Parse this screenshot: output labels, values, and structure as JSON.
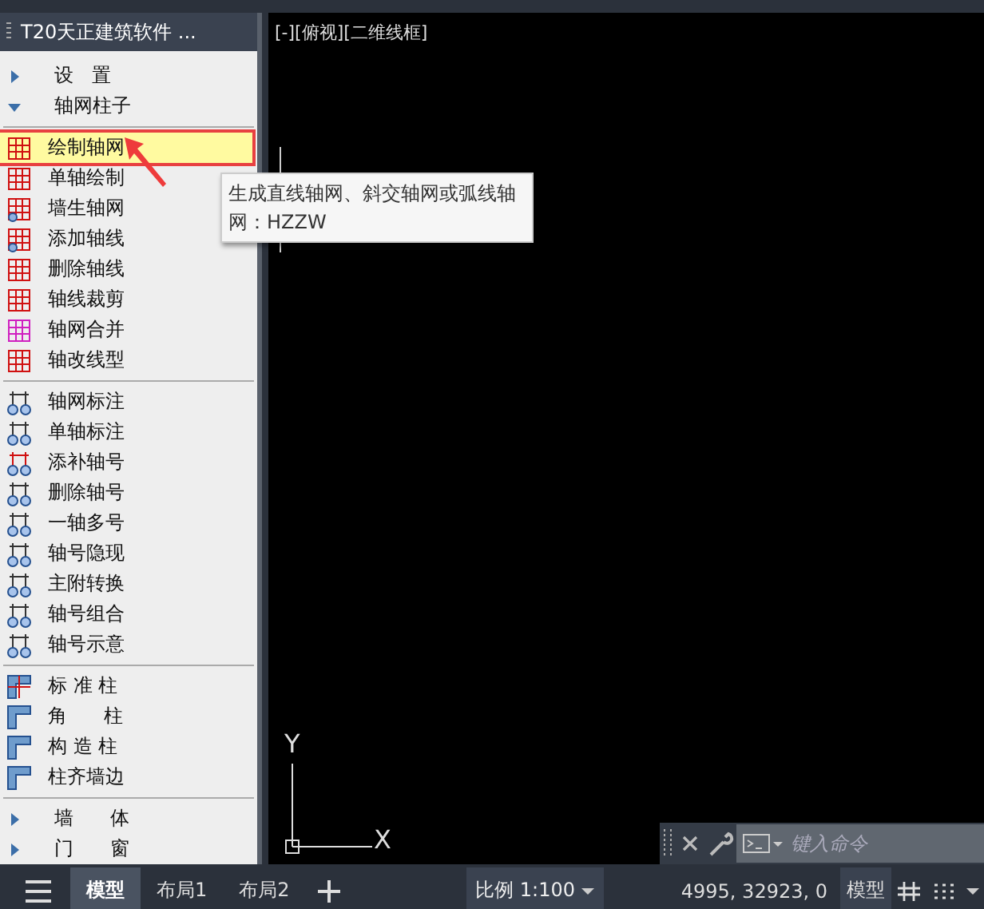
{
  "palette": {
    "title": "T20天正建筑软件 ...",
    "items": [
      {
        "kind": "group",
        "label": "设   置",
        "expanded": false
      },
      {
        "kind": "group",
        "label": "轴网柱子",
        "expanded": true
      },
      {
        "kind": "separator"
      },
      {
        "kind": "tool",
        "label": "绘制轴网",
        "selected": true
      },
      {
        "kind": "tool",
        "label": "单轴绘制",
        "selected": false
      },
      {
        "kind": "tool",
        "label": "墙生轴网",
        "selected": false
      },
      {
        "kind": "tool",
        "label": "添加轴线",
        "selected": false
      },
      {
        "kind": "tool",
        "label": "删除轴线",
        "selected": false
      },
      {
        "kind": "tool",
        "label": "轴线裁剪",
        "selected": false
      },
      {
        "kind": "tool",
        "label": "轴网合并",
        "selected": false
      },
      {
        "kind": "tool",
        "label": "轴改线型",
        "selected": false
      },
      {
        "kind": "separator"
      },
      {
        "kind": "tool",
        "label": "轴网标注",
        "selected": false
      },
      {
        "kind": "tool",
        "label": "单轴标注",
        "selected": false
      },
      {
        "kind": "tool",
        "label": "添补轴号",
        "selected": false
      },
      {
        "kind": "tool",
        "label": "删除轴号",
        "selected": false
      },
      {
        "kind": "tool",
        "label": "一轴多号",
        "selected": false
      },
      {
        "kind": "tool",
        "label": "轴号隐现",
        "selected": false
      },
      {
        "kind": "tool",
        "label": "主附转换",
        "selected": false
      },
      {
        "kind": "tool",
        "label": "轴号组合",
        "selected": false
      },
      {
        "kind": "tool",
        "label": "轴号示意",
        "selected": false
      },
      {
        "kind": "separator"
      },
      {
        "kind": "tool",
        "label": "标 准 柱",
        "selected": false
      },
      {
        "kind": "tool",
        "label": "角      柱",
        "selected": false
      },
      {
        "kind": "tool",
        "label": "构 造 柱",
        "selected": false
      },
      {
        "kind": "tool",
        "label": "柱齐墙边",
        "selected": false
      },
      {
        "kind": "separator"
      },
      {
        "kind": "group",
        "label": "墙      体",
        "expanded": false
      },
      {
        "kind": "group",
        "label": "门      窗",
        "expanded": false
      }
    ]
  },
  "tooltip": {
    "text": "生成直线轴网、斜交轴网或弧线轴网：HZZW"
  },
  "viewport": {
    "label": "[-][俯视][二维线框]",
    "axis_y": "Y",
    "axis_x": "X"
  },
  "command_line": {
    "placeholder": "键入命令"
  },
  "status_bar": {
    "tabs": [
      {
        "label": "模型",
        "selected": true
      },
      {
        "label": "布局1",
        "selected": false
      },
      {
        "label": "布局2",
        "selected": false
      }
    ],
    "scale": "比例 1:100",
    "coordinates": "4995, 32923, 0",
    "space": "模型"
  }
}
